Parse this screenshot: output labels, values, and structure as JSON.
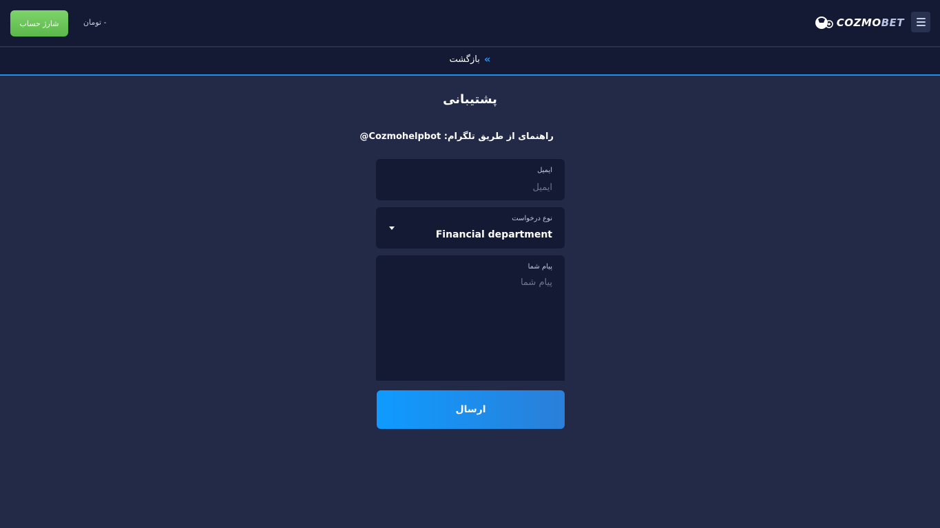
{
  "header": {
    "charge_button_label": "شارژ حساب",
    "balance_text": "- تومان",
    "logo": {
      "part1": "COZMO",
      "part2": "BET"
    },
    "menu_icon": "hamburger-icon"
  },
  "subbar": {
    "back_label": "بازگشت",
    "back_icon": "double-chevron-right-icon"
  },
  "page": {
    "title": "پشتیبانی",
    "guide_prefix": "راهنمای از طریق تلگرام: ",
    "guide_handle": "@Cozmohelpbot"
  },
  "form": {
    "email": {
      "label": "ایمیل",
      "placeholder": "ایمیل",
      "value": ""
    },
    "request_type": {
      "label": "نوع درخواست",
      "selected": "Financial department"
    },
    "message": {
      "label": "پیام شما",
      "placeholder": "پیام شما",
      "value": ""
    },
    "submit_label": "ارسال"
  },
  "colors": {
    "background": "#232a47",
    "header": "#141a33",
    "accent": "#1f8fe8",
    "charge_green": "#6cc45a"
  }
}
